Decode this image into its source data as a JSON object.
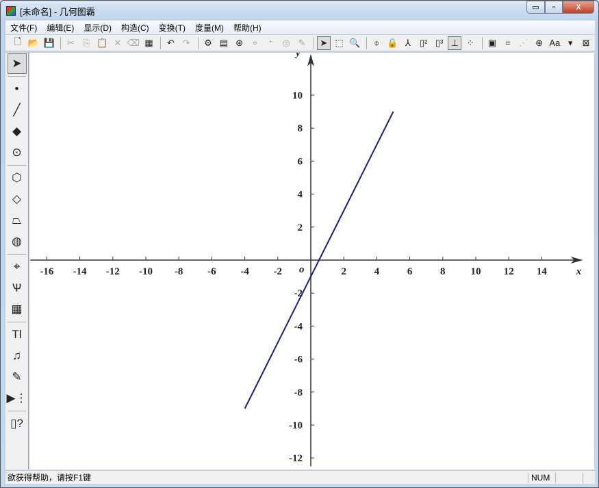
{
  "window": {
    "title": "[未命名] - 几何图霸",
    "minimize": "▭",
    "maximize": "▫",
    "close": "X"
  },
  "menu": [
    "文件(F)",
    "编辑(E)",
    "显示(D)",
    "构造(C)",
    "变换(T)",
    "度量(M)",
    "帮助(H)"
  ],
  "toolbar": [
    {
      "icon": "new-icon",
      "g": "🗋"
    },
    {
      "icon": "open-icon",
      "g": "📂"
    },
    {
      "icon": "save-icon",
      "g": "💾"
    },
    "|",
    {
      "icon": "cut-icon",
      "g": "✂",
      "dis": true
    },
    {
      "icon": "copy-icon",
      "g": "⎘",
      "dis": true
    },
    {
      "icon": "paste-icon",
      "g": "📋",
      "dis": true
    },
    {
      "icon": "delete-icon",
      "g": "✕",
      "dis": true
    },
    {
      "icon": "eraser-icon",
      "g": "⌫",
      "dis": true
    },
    {
      "icon": "clear-icon",
      "g": "▦"
    },
    "|",
    {
      "icon": "undo-icon",
      "g": "↶"
    },
    {
      "icon": "redo-icon",
      "g": "↷",
      "dis": true
    },
    "|",
    {
      "icon": "settings-icon",
      "g": "⚙"
    },
    {
      "icon": "properties-icon",
      "g": "▤"
    },
    {
      "icon": "animation-icon",
      "g": "⊛"
    },
    {
      "icon": "trace-icon",
      "g": "⌖",
      "dis": true
    },
    {
      "icon": "add-point-icon",
      "g": "⁺",
      "dis": true
    },
    {
      "icon": "hide-icon",
      "g": "◎",
      "dis": true
    },
    {
      "icon": "brush-icon",
      "g": "✎",
      "dis": true
    },
    "|",
    {
      "icon": "select-arrow-icon",
      "g": "➤",
      "on": true
    },
    {
      "icon": "select-region-icon",
      "g": "⬚"
    },
    {
      "icon": "find-icon",
      "g": "🔍"
    },
    "|",
    {
      "icon": "axis-symmetry-icon",
      "g": "⌽"
    },
    {
      "icon": "lock-select-icon",
      "g": "🔒"
    },
    {
      "icon": "lock-point-icon",
      "g": "⅄"
    },
    {
      "icon": "label-2-icon",
      "g": "▯²"
    },
    {
      "icon": "label-3-icon",
      "g": "▯³"
    },
    {
      "icon": "coordinate-axes-icon",
      "g": "⊥",
      "on": true
    },
    {
      "icon": "grid-icon",
      "g": "⁘"
    },
    "|",
    {
      "icon": "text-box-icon",
      "g": "▣"
    },
    {
      "icon": "point-coords-icon",
      "g": "⌗"
    },
    {
      "icon": "dashed-line-icon",
      "g": "⋰",
      "dis": true
    },
    {
      "icon": "circle-point-icon",
      "g": "⊕"
    },
    {
      "icon": "font-icon",
      "g": "Aa"
    },
    {
      "icon": "dropdown-icon",
      "g": "▾"
    },
    {
      "icon": "close-image-icon",
      "g": "⊠"
    }
  ],
  "tools": [
    {
      "icon": "arrow-select-icon",
      "g": "➤",
      "on": true
    },
    "|",
    {
      "icon": "point-tool-icon",
      "g": "•"
    },
    {
      "icon": "segment-tool-icon",
      "g": "╱"
    },
    {
      "icon": "polygon-tool-icon",
      "g": "◆"
    },
    {
      "icon": "circle-tool-icon",
      "g": "⊙"
    },
    "|",
    {
      "icon": "cube-tool-icon",
      "g": "⬡"
    },
    {
      "icon": "pyramid-tool-icon",
      "g": "◇"
    },
    {
      "icon": "frustum-tool-icon",
      "g": "⏢"
    },
    {
      "icon": "sphere-tool-icon",
      "g": "◍"
    },
    "|",
    {
      "icon": "coordinate-tool-icon",
      "g": "⌖"
    },
    {
      "icon": "function-graph-icon",
      "g": "Ѱ"
    },
    {
      "icon": "calculator-icon",
      "g": "▦"
    },
    "|",
    {
      "icon": "text-tool-icon",
      "g": "Tl"
    },
    {
      "icon": "media-tool-icon",
      "g": "♫"
    },
    {
      "icon": "pen-tool-icon",
      "g": "✎"
    },
    {
      "icon": "animation-tool-icon",
      "g": "▶⋮"
    },
    "|",
    {
      "icon": "help-tool-icon",
      "g": "▯?"
    }
  ],
  "status": {
    "message": "欲获得帮助，请按F1键",
    "num": "NUM"
  },
  "chart_data": {
    "type": "line",
    "xlabel": "x",
    "ylabel": "y",
    "origin_label": "o",
    "xlim": [
      -17,
      16.5
    ],
    "ylim": [
      -12.5,
      12.5
    ],
    "xticks": [
      -16,
      -14,
      -12,
      -10,
      -8,
      -6,
      -4,
      -2,
      2,
      4,
      6,
      8,
      10,
      12,
      14
    ],
    "yticks": [
      10,
      8,
      6,
      4,
      2,
      -2,
      -4,
      -6,
      -8,
      -10,
      -12
    ],
    "series": [
      {
        "x": [
          -4,
          5
        ],
        "y": [
          -9,
          9
        ],
        "color": "#1a1a80"
      }
    ],
    "grid": false
  }
}
